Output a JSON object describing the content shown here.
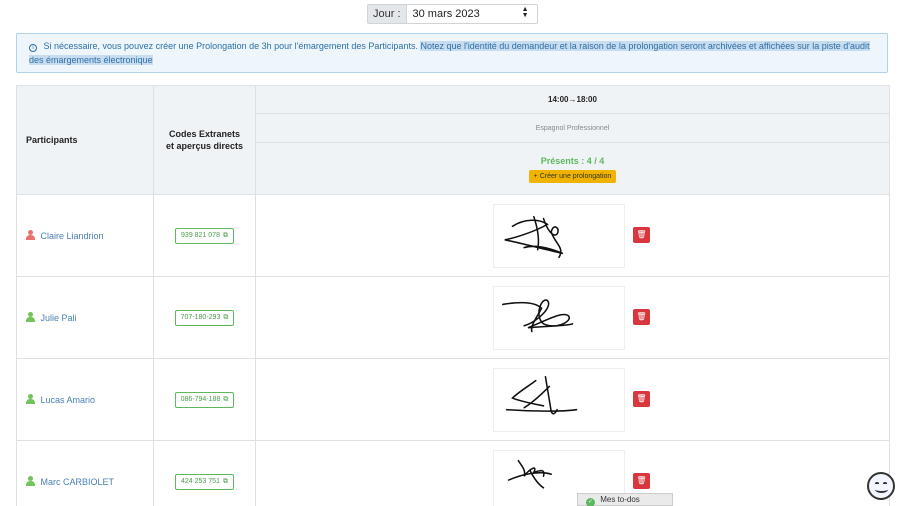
{
  "day": {
    "label": "Jour :",
    "value": "30 mars 2023"
  },
  "info": {
    "text": "Si nécessaire, vous pouvez créer une Prolongation de 3h pour l'émargement des Participants.",
    "highlight": "Notez que l'identité du demandeur et la raison de la prolongation seront archivées et affichées sur la piste d'audit des émargements électronique"
  },
  "table": {
    "header": {
      "participants": "Participants",
      "codes_line1": "Codes Extranets",
      "codes_line2": "et aperçus directs",
      "time": "14:00→18:00",
      "course": "Espagnol Professionnel",
      "presents": "Présents : 4 / 4",
      "prolong_button": "+ Créer une prolongation"
    },
    "rows": [
      {
        "name": "Claire Liandrion",
        "code": "939 821 078",
        "icon_color": "#e8716e"
      },
      {
        "name": "Julie Pali",
        "code": "707-180-293",
        "icon_color": "#72c35a"
      },
      {
        "name": "Lucas Amario",
        "code": "086-794-188",
        "icon_color": "#72c35a"
      },
      {
        "name": "Marc CARBIOLET",
        "code": "424 253 751",
        "icon_color": "#72c35a"
      }
    ]
  },
  "todos": {
    "label": "Mes to-dos"
  },
  "icons": {
    "info": "info-icon",
    "person": "person-icon",
    "external": "external-link-icon",
    "delete": "trash-icon",
    "check": "check-icon",
    "assistant": "smiley-icon"
  }
}
